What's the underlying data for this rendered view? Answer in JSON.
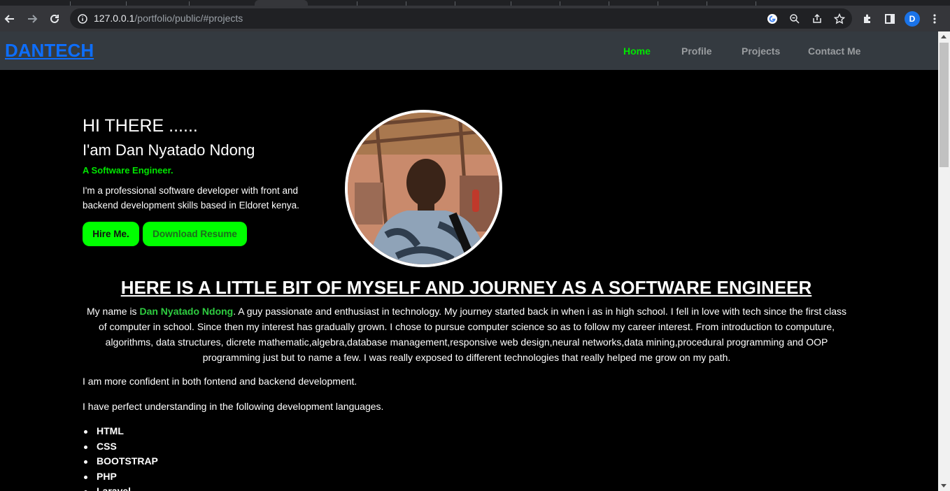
{
  "browser": {
    "url_host": "127.0.0.1",
    "url_path": "/portfolio/public/#projects",
    "profile_initial": "D"
  },
  "site": {
    "brand": "DANTECH",
    "nav": {
      "home": "Home",
      "profile": "Profile",
      "projects": "Projects",
      "contact": "Contact Me"
    },
    "accent_color": "#00ff00",
    "brand_color": "#0d6efd"
  },
  "hero": {
    "greeting": "HI THERE ......",
    "name": "I'am Dan Nyatado Ndong",
    "role": "A Software Engineer.",
    "description": "I'm a professional software developer with front and backend development skills based in Eldoret kenya.",
    "hire_button": "Hire Me.",
    "resume_button": "Download Resume"
  },
  "about": {
    "title": "HERE IS A LITTLE BIT OF MYSELF AND JOURNEY AS A SOFTWARE ENGINEER",
    "intro_prefix": "My name is ",
    "intro_name": "Dan Nyatado Ndong",
    "intro_rest": ". A guy passionate and enthusiast in technology. My journey started back in when i as in high school. I fell in love with tech since the first class of computer in school. Since then my interest has gradually grown. I chose to pursue computer science so as to follow my career interest. From introduction to computure, algorithms, data structures, dicrete mathematic,algebra,database management,responsive web design,neural networks,data mining,procedural programming and OOP programming just but to name a few. I was really exposed to different technologies that really helped me grow on my path.",
    "confidence": "I am more confident in both fontend and backend development.",
    "languages_intro": "I have perfect understanding in the following development languages.",
    "languages": [
      "HTML",
      "CSS",
      "BOOTSTRAP",
      "PHP",
      "Laravel"
    ]
  }
}
